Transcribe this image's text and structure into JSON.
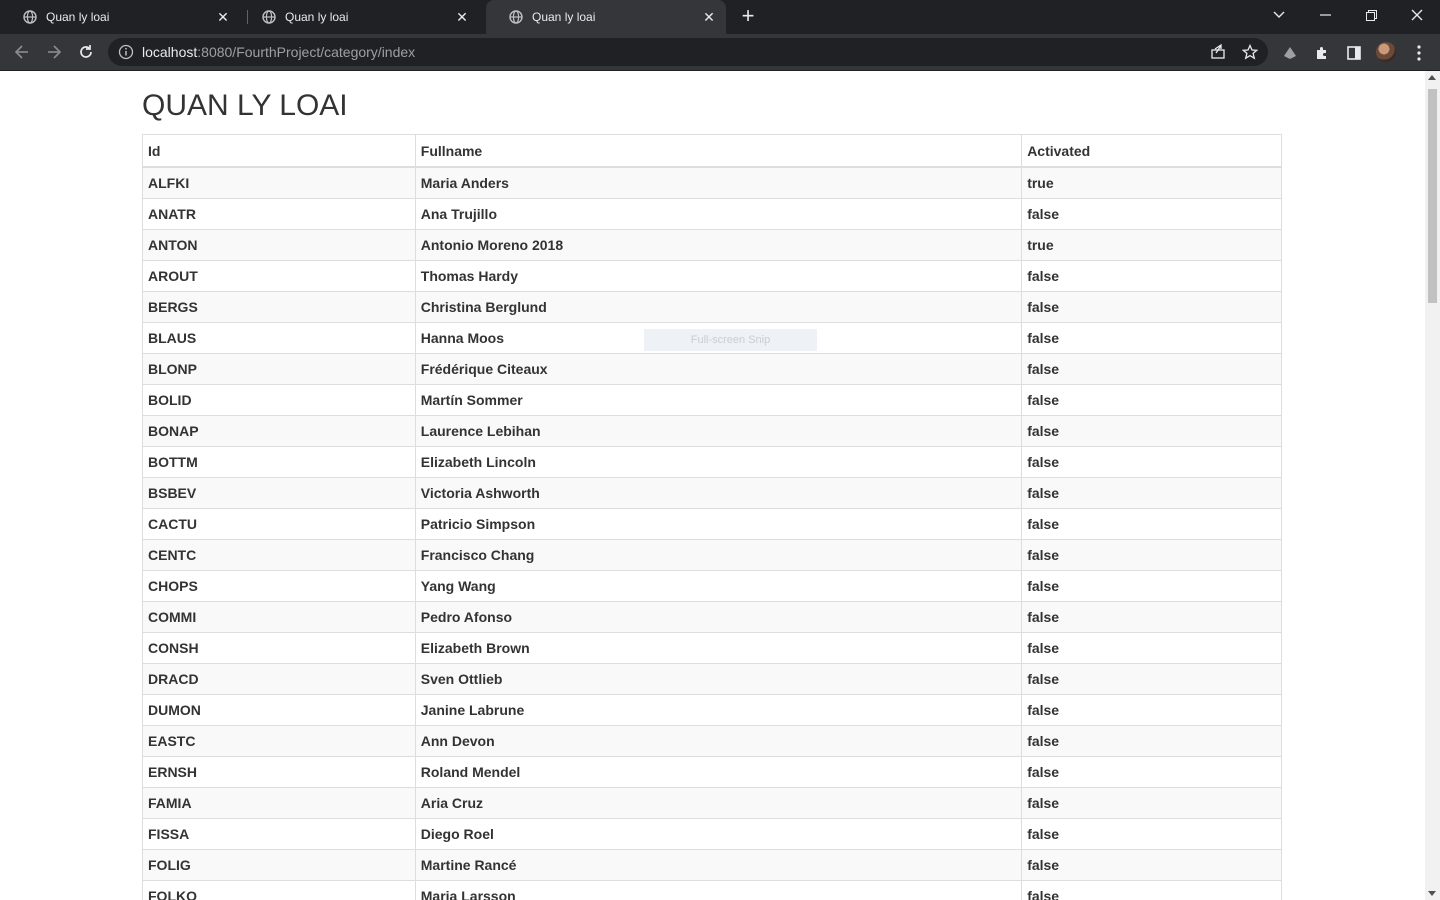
{
  "browser": {
    "tabs": [
      {
        "title": "Quan ly loai",
        "active": false
      },
      {
        "title": "Quan ly loai",
        "active": false
      },
      {
        "title": "Quan ly loai",
        "active": true
      }
    ],
    "url_host": "localhost",
    "url_rest": ":8080/FourthProject/category/index"
  },
  "page": {
    "heading": "QUAN LY LOAI",
    "columns": [
      "Id",
      "Fullname",
      "Activated"
    ],
    "rows": [
      [
        "ALFKI",
        "Maria Anders",
        "true"
      ],
      [
        "ANATR",
        "Ana Trujillo",
        "false"
      ],
      [
        "ANTON",
        "Antonio Moreno 2018",
        "true"
      ],
      [
        "AROUT",
        "Thomas Hardy",
        "false"
      ],
      [
        "BERGS",
        "Christina Berglund",
        "false"
      ],
      [
        "BLAUS",
        "Hanna Moos",
        "false"
      ],
      [
        "BLONP",
        "Frédérique Citeaux",
        "false"
      ],
      [
        "BOLID",
        "Martín Sommer",
        "false"
      ],
      [
        "BONAP",
        "Laurence Lebihan",
        "false"
      ],
      [
        "BOTTM",
        "Elizabeth Lincoln",
        "false"
      ],
      [
        "BSBEV",
        "Victoria Ashworth",
        "false"
      ],
      [
        "CACTU",
        "Patricio Simpson",
        "false"
      ],
      [
        "CENTC",
        "Francisco Chang",
        "false"
      ],
      [
        "CHOPS",
        "Yang Wang",
        "false"
      ],
      [
        "COMMI",
        "Pedro Afonso",
        "false"
      ],
      [
        "CONSH",
        "Elizabeth Brown",
        "false"
      ],
      [
        "DRACD",
        "Sven Ottlieb",
        "false"
      ],
      [
        "DUMON",
        "Janine Labrune",
        "false"
      ],
      [
        "EASTC",
        "Ann Devon",
        "false"
      ],
      [
        "ERNSH",
        "Roland Mendel",
        "false"
      ],
      [
        "FAMIA",
        "Aria Cruz",
        "false"
      ],
      [
        "FISSA",
        "Diego Roel",
        "false"
      ],
      [
        "FOLIG",
        "Martine Rancé",
        "false"
      ],
      [
        "FOLKO",
        "Maria Larsson",
        "false"
      ]
    ],
    "overlay_text": "Full-screen Snip"
  },
  "icons": {
    "favicon": "globe-icon",
    "back": "back-arrow-icon",
    "forward": "forward-arrow-icon",
    "reload": "reload-icon",
    "info": "info-icon",
    "share": "share-icon",
    "bookmark": "star-icon",
    "extensions": "puzzle-icon"
  }
}
